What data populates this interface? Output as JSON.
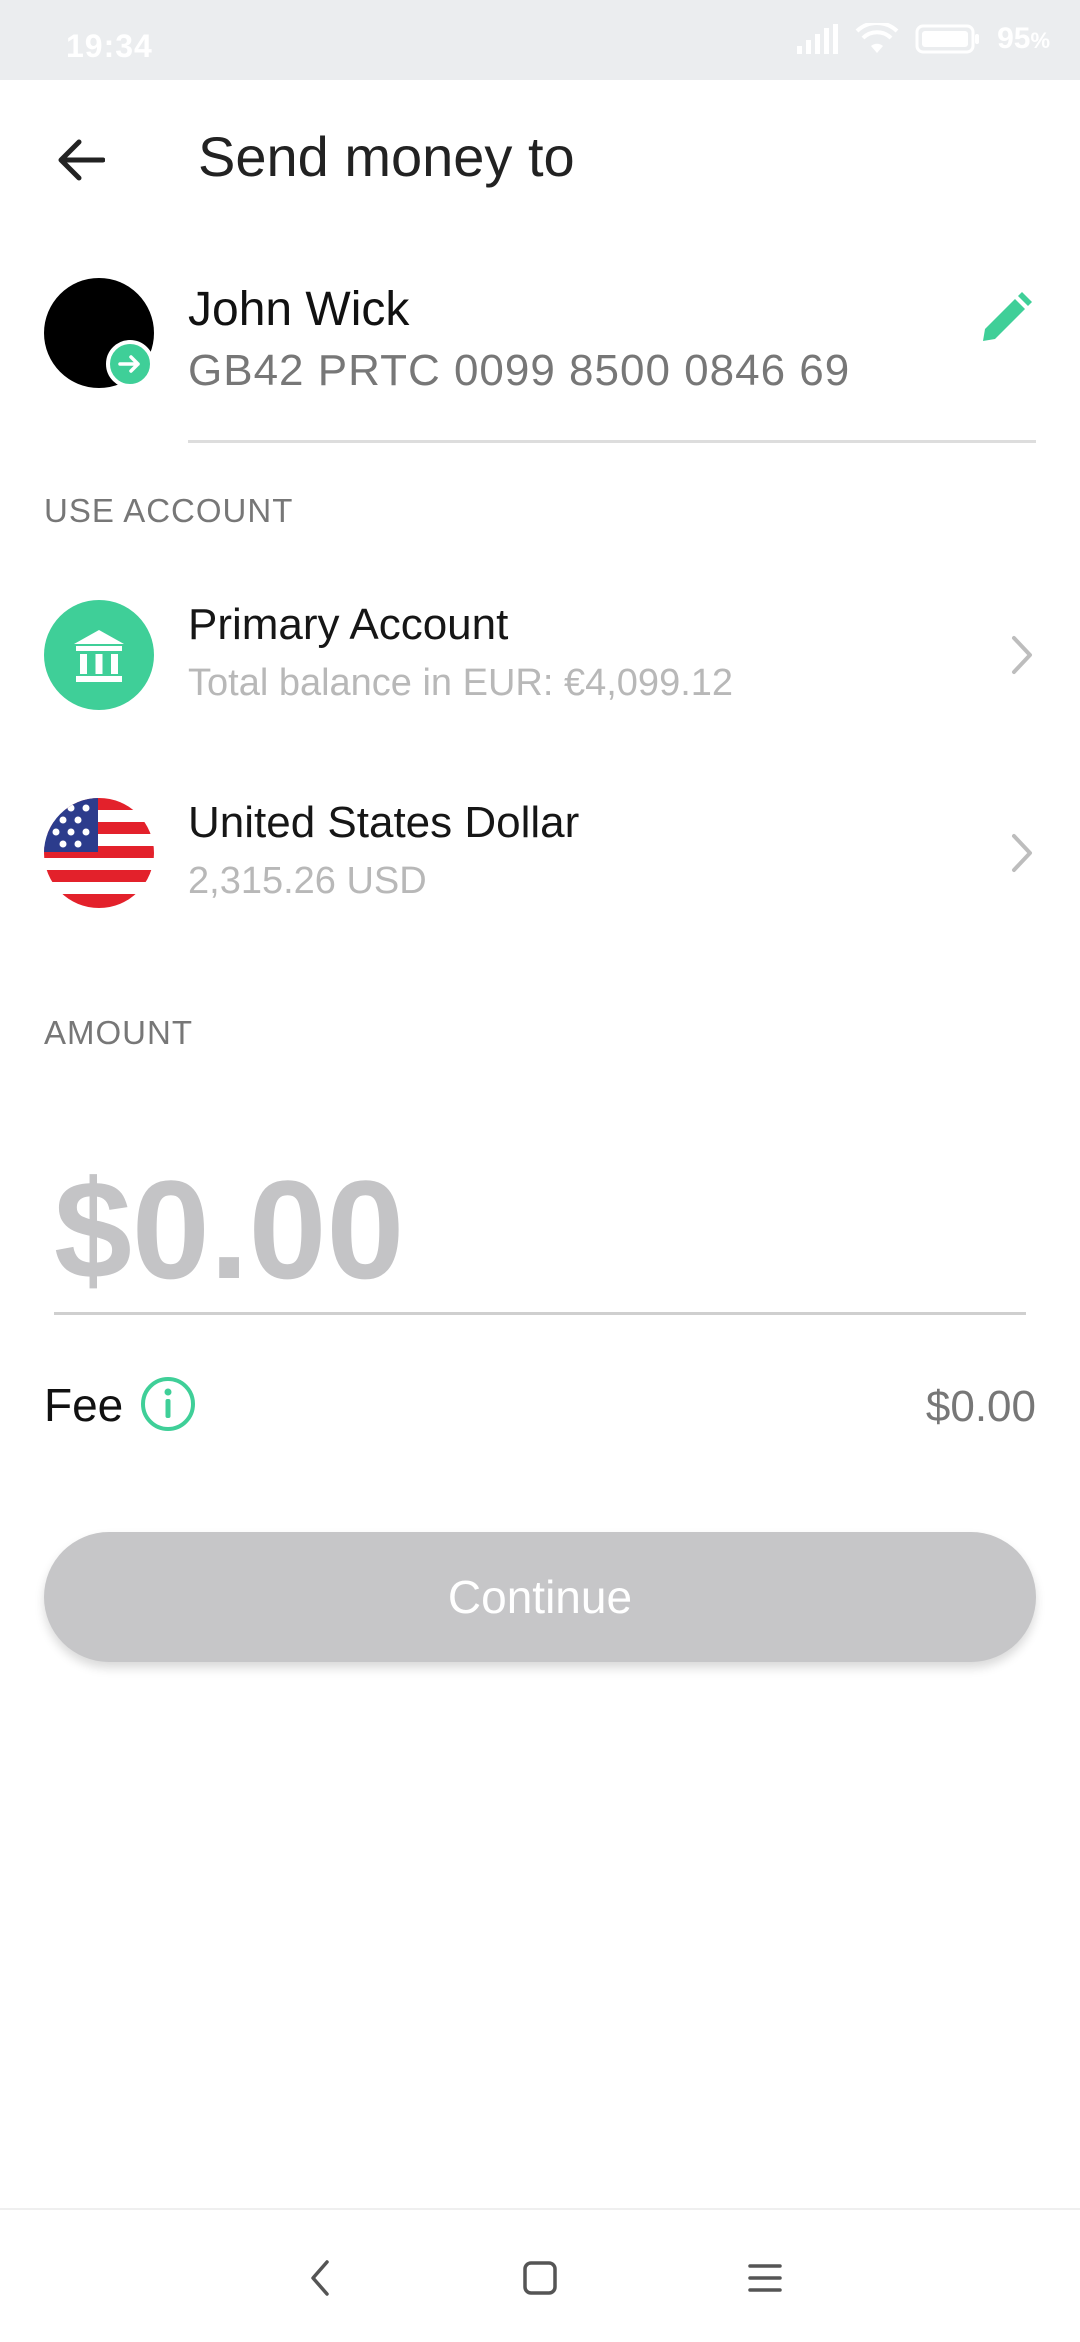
{
  "status_bar": {
    "time": "19:34",
    "battery": "95",
    "battery_unit": "%"
  },
  "header": {
    "title": "Send money to"
  },
  "recipient": {
    "name": "John Wick",
    "iban": "GB42 PRTC 0099 8500 0846 69"
  },
  "use_account": {
    "label": "USE ACCOUNT",
    "accounts": [
      {
        "title": "Primary Account",
        "subtitle": "Total balance in EUR: €4,099.12",
        "icon": "bank-icon"
      },
      {
        "title": "United States Dollar",
        "subtitle": "2,315.26 USD",
        "icon": "us-flag-icon"
      }
    ]
  },
  "amount": {
    "label": "AMOUNT",
    "placeholder": "$0.00"
  },
  "fee": {
    "label": "Fee",
    "value": "$0.00"
  },
  "continue_label": "Continue",
  "colors": {
    "accent": "#3fcf98",
    "disabled_button": "#c6c6c8",
    "status_bar_bg": "#ebedef"
  }
}
